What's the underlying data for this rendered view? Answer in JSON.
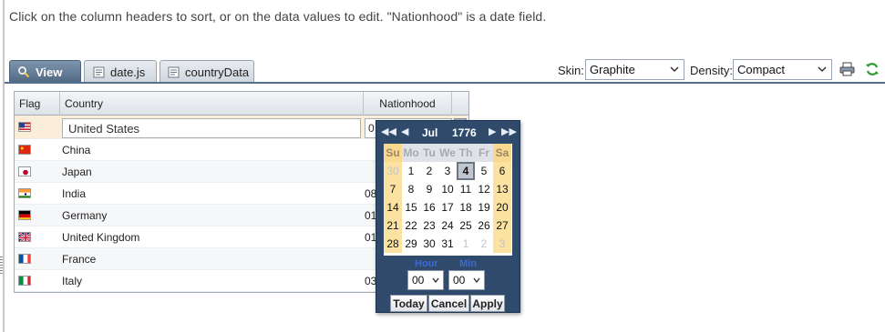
{
  "instructions": "Click on the column headers to sort, or on the data values to edit. \"Nationhood\" is a date field.",
  "tabs": [
    {
      "label": "View",
      "icon": "magnifier-icon",
      "selected": true
    },
    {
      "label": "date.js",
      "icon": "file-icon",
      "selected": false
    },
    {
      "label": "countryData",
      "icon": "file-icon",
      "selected": false
    }
  ],
  "toolbar": {
    "skin_label": "Skin:",
    "skin_value": "Graphite",
    "density_label": "Density:",
    "density_value": "Compact",
    "print_icon": "printer-icon",
    "refresh_icon": "refresh-icon"
  },
  "grid": {
    "columns": [
      "Flag",
      "Country",
      "Nationhood"
    ],
    "editing": {
      "country": "United States",
      "nationhood": "0"
    },
    "rows": [
      {
        "flag": "flag-us",
        "country": "United States",
        "nationhood": ""
      },
      {
        "flag": "flag-cn",
        "country": "China",
        "nationhood": ""
      },
      {
        "flag": "flag-jp",
        "country": "Japan",
        "nationhood": ""
      },
      {
        "flag": "flag-in",
        "country": "India",
        "nationhood": "08"
      },
      {
        "flag": "flag-de",
        "country": "Germany",
        "nationhood": "01"
      },
      {
        "flag": "flag-gb",
        "country": "United Kingdom",
        "nationhood": "01"
      },
      {
        "flag": "flag-fr",
        "country": "France",
        "nationhood": ""
      },
      {
        "flag": "flag-it",
        "country": "Italy",
        "nationhood": "03"
      }
    ]
  },
  "date_chooser": {
    "month": "Jul",
    "year": "1776",
    "weekdays": [
      "Su",
      "Mo",
      "Tu",
      "We",
      "Th",
      "Fr",
      "Sa"
    ],
    "weeks": [
      [
        "30",
        "1",
        "2",
        "3",
        "4",
        "5",
        "6"
      ],
      [
        "7",
        "8",
        "9",
        "10",
        "11",
        "12",
        "13"
      ],
      [
        "14",
        "15",
        "16",
        "17",
        "18",
        "19",
        "20"
      ],
      [
        "21",
        "22",
        "23",
        "24",
        "25",
        "26",
        "27"
      ],
      [
        "28",
        "29",
        "30",
        "31",
        "1",
        "2",
        "3"
      ]
    ],
    "selected_day": "4",
    "hour_label": "Hour",
    "min_label": "Min",
    "hour_value": "00",
    "min_value": "00",
    "buttons": {
      "today": "Today",
      "cancel": "Cancel",
      "apply": "Apply"
    },
    "colors": {
      "header": "#2f4a6b",
      "weekend": "#fbe2a0",
      "selected": "#bfc6cf"
    }
  }
}
